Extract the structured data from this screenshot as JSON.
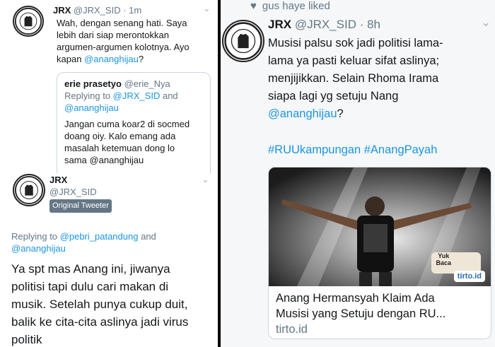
{
  "panel1": {
    "author_name": "JRX",
    "author_handle": "@JRX_SID",
    "time": "· 1m",
    "text_lines": [
      "Wah, dengan senang hati. Saya",
      "lebih dari siap merontokkan",
      "argumen-argumen kolotnya. Ayo"
    ],
    "text_last_prefix": "kapan",
    "mention": "@ananghijau",
    "text_last_suffix": "?",
    "quote": {
      "author_name": "erie prasetyo",
      "author_handle": "@erie_Nya",
      "replying_prefix": "Replying to",
      "replying_mention1": "@JRX_SID",
      "replying_and": "and",
      "replying_mention2": "@ananghijau",
      "lines": [
        "Jangan cuma koar2 di socmed",
        "doang oiy. Kalo emang ada",
        "masalah ketemuan dong lo",
        "sama @ananghijau"
      ]
    }
  },
  "panel2": {
    "author_name": "JRX",
    "author_handle": "@JRX_SID",
    "badge": "Original Tweeter",
    "replying_prefix": "Replying to",
    "replying_mention1": "@pebri_patandung",
    "replying_and": "and",
    "replying_mention2": "@ananghijau",
    "lines": [
      "Ya spt mas Anang ini, jiwanya",
      "politisi tapi dulu cari makan di",
      "musik. Setelah punya cukup duit,",
      "balik ke cita-cita aslinya jadi virus",
      "politik"
    ]
  },
  "panel3": {
    "liked_text": "gus haye liked",
    "author_name": "JRX",
    "author_handle": "@JRX_SID",
    "time": "· 8h",
    "lines": [
      "Musisi palsu sok jadi politisi lama-",
      "lama ya pasti keluar sifat aslinya;",
      "menjijikkan. Selain Rhoma Irama",
      "siapa lagi yg setuju Nang"
    ],
    "mention": "@ananghijau",
    "mention_suffix": "?",
    "hashtags": "#RUUkampungan #AnangPayah",
    "card": {
      "title_lines": [
        "Anang Hermansyah Klaim Ada",
        "Musisi yang Setuju dengan RU..."
      ],
      "domain": "tirto.id",
      "overlay_text1": "Yuk",
      "overlay_text2": "Baca",
      "overlay_logo": "tirto.id"
    }
  },
  "avatar_ring_text": "TOLAK RECLAMASI TELUK BENOA"
}
